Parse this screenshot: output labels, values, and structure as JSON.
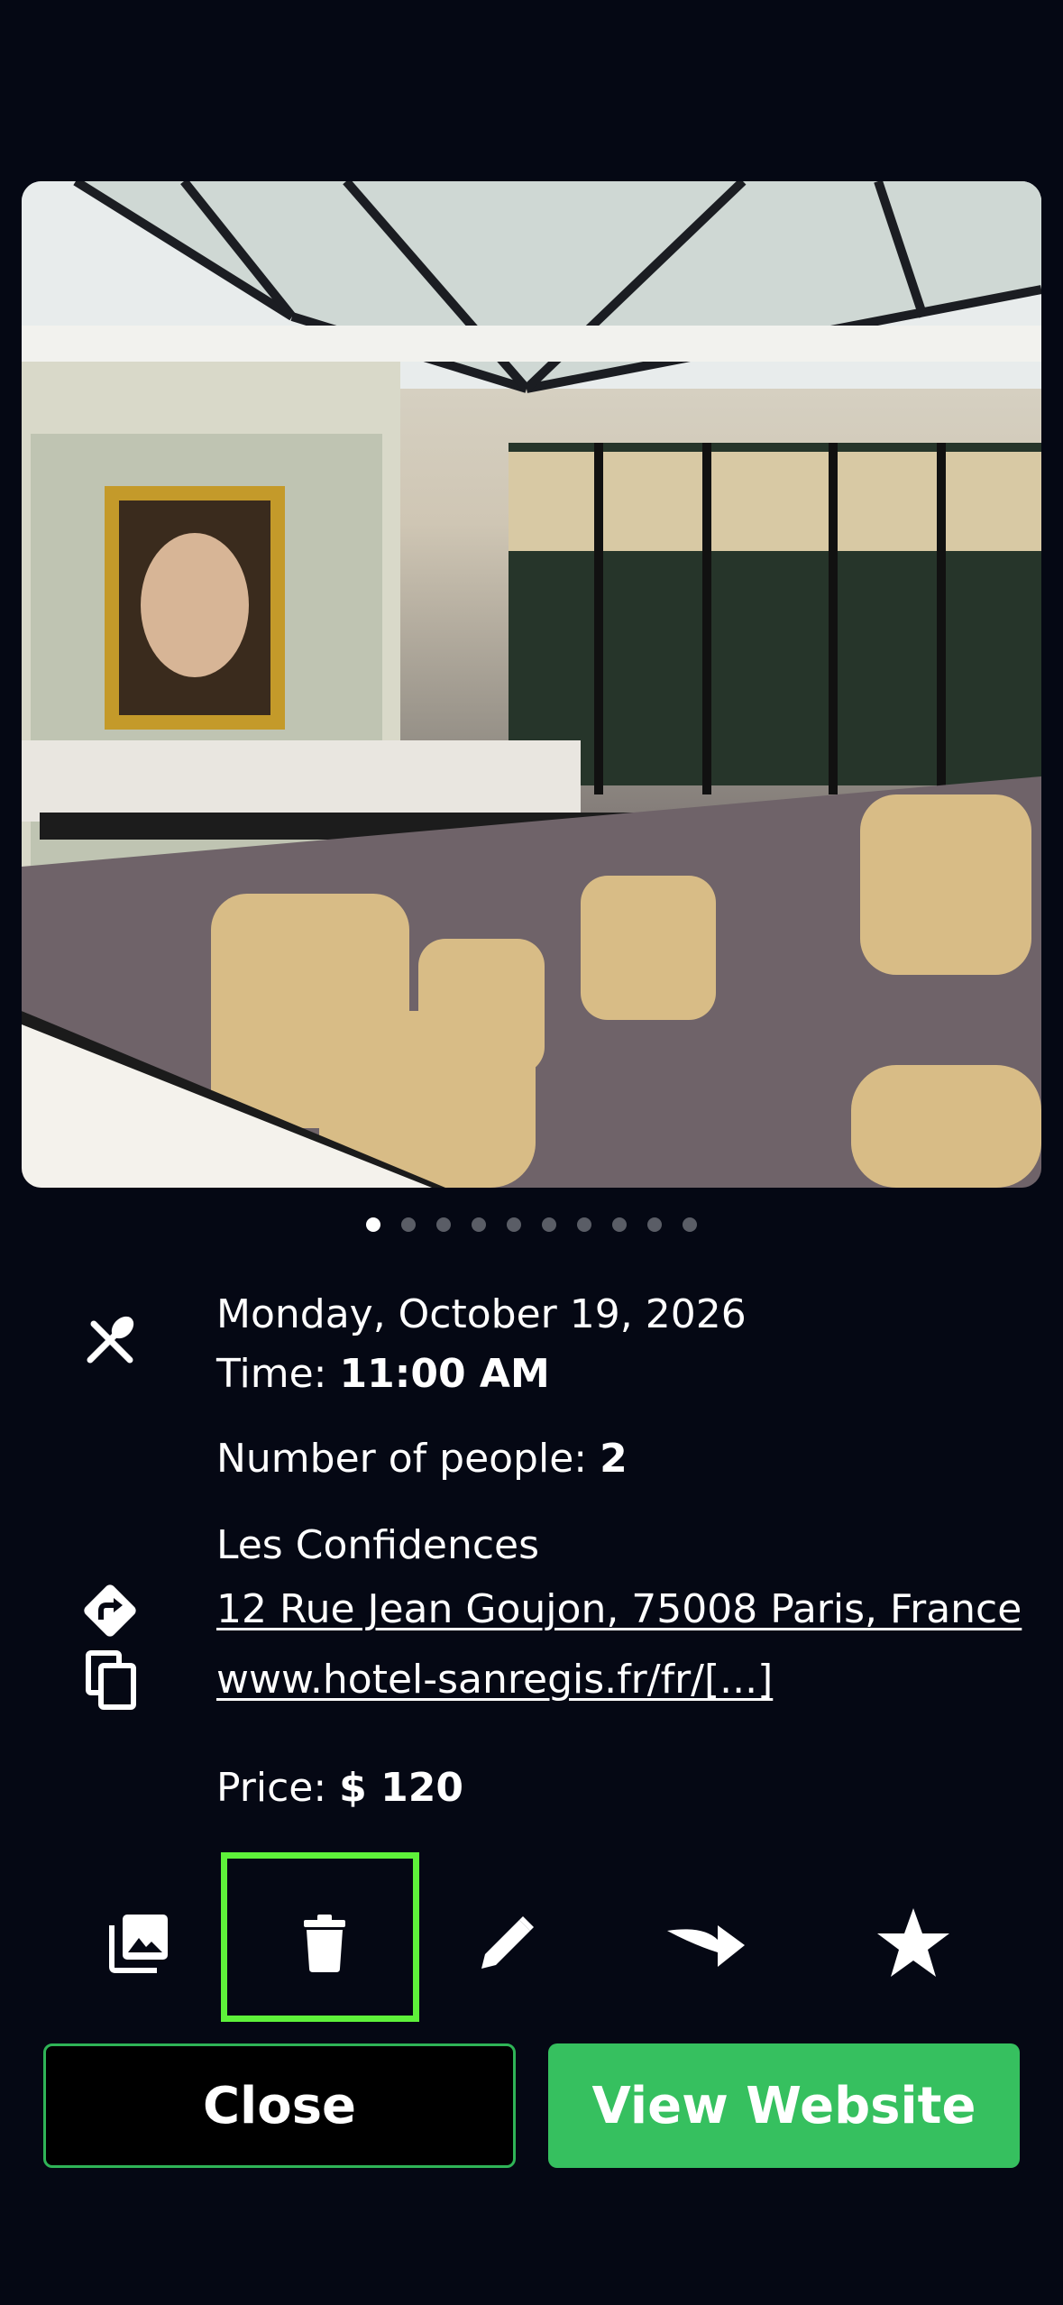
{
  "photo": {
    "alt": "Restaurant dining room with glass ceiling"
  },
  "gallery": {
    "total_images": 10,
    "current_index": 1
  },
  "reservation": {
    "date": "Monday, October 19, 2026",
    "time_label": "Time:",
    "time_value": "11:00 AM",
    "people_label": "Number of people:",
    "people_value": "2",
    "restaurant_name": "Les Confidences",
    "address": "12 Rue Jean Goujon, 75008 Paris, France",
    "website": "www.hotel-sanregis.fr/fr/[...]",
    "price_label": "Price:",
    "price_value": "$ 120"
  },
  "icons": {
    "dining": "fork-knife-icon",
    "directions": "directions-icon",
    "copy": "copy-icon",
    "gallery": "photo-library-icon",
    "delete": "trash-icon",
    "edit": "pencil-icon",
    "share": "share-arrow-icon",
    "favorite": "star-icon"
  },
  "buttons": {
    "close": "Close",
    "view_website": "View Website"
  },
  "colors": {
    "background": "#050814",
    "accent_green": "#36c05f",
    "highlight": "#5ef13a"
  }
}
